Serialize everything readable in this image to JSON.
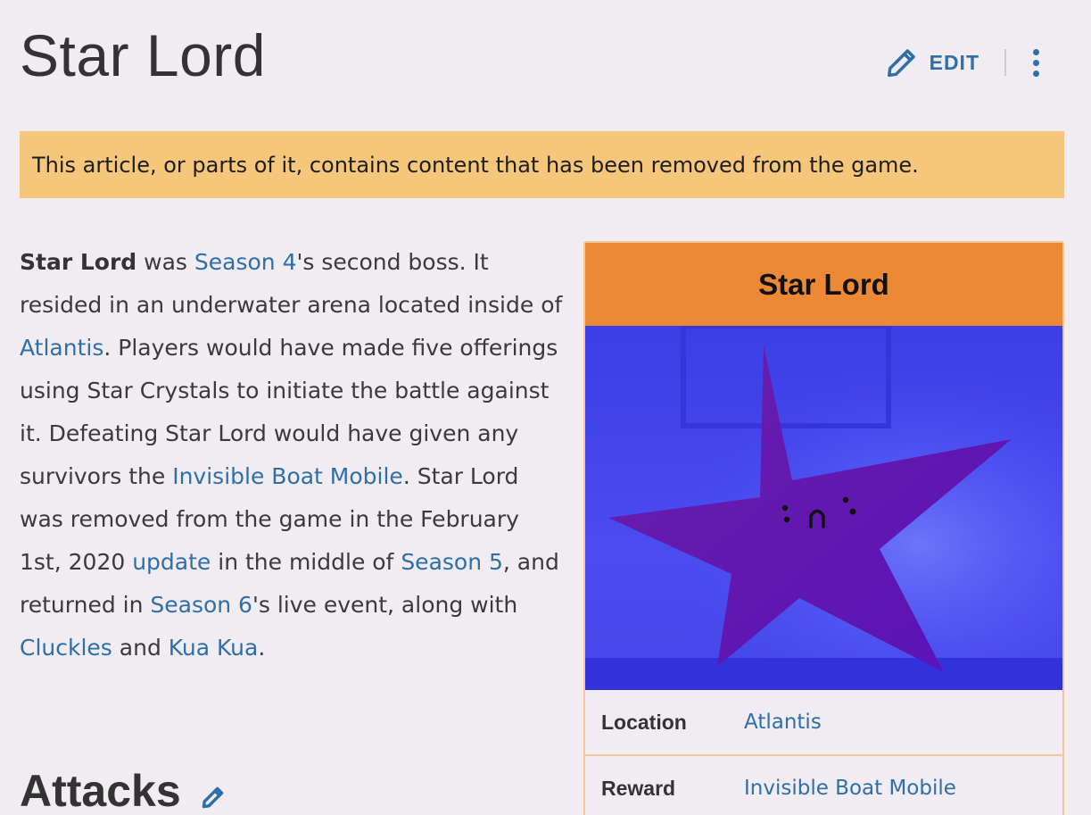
{
  "page": {
    "title": "Star Lord",
    "edit_label": "EDIT"
  },
  "notice": {
    "text": "This article, or parts of it, contains content that has been removed from the game."
  },
  "article": {
    "t1": "Star Lord",
    "t2": " was ",
    "l1": "Season 4",
    "t3": "'s second boss. It resided in an underwater arena located inside of ",
    "l2": "Atlantis",
    "t4": ". Players would have made five offerings using Star Crystals to initiate the battle against it. Defeating Star Lord would have given any survivors the ",
    "l3": "Invisible Boat Mobile",
    "t5": ". Star Lord was removed from the game in the February 1st, 2020 ",
    "l4": "update",
    "t6": " in the middle of ",
    "l5": "Season 5",
    "t7": ", and returned in ",
    "l6": "Season 6",
    "t8": "'s live event, along with ",
    "l7": "Cluckles",
    "t9": " and ",
    "l8": "Kua Kua",
    "t10": "."
  },
  "sections": {
    "attacks_heading": "Attacks"
  },
  "infobox": {
    "title": "Star Lord",
    "rows": [
      {
        "label": "Location",
        "value": "Atlantis"
      },
      {
        "label": "Reward",
        "value": "Invisible Boat Mobile"
      }
    ]
  },
  "icons": {
    "edit": "pencil-icon",
    "more": "kebab-menu-icon",
    "section_edit": "pencil-icon"
  },
  "colors": {
    "background": "#f1ebf2",
    "link": "#2f6fa8",
    "notice": "#f6c67a",
    "infobox_header": "#ed8834",
    "infobox_border": "#f0c89a"
  }
}
